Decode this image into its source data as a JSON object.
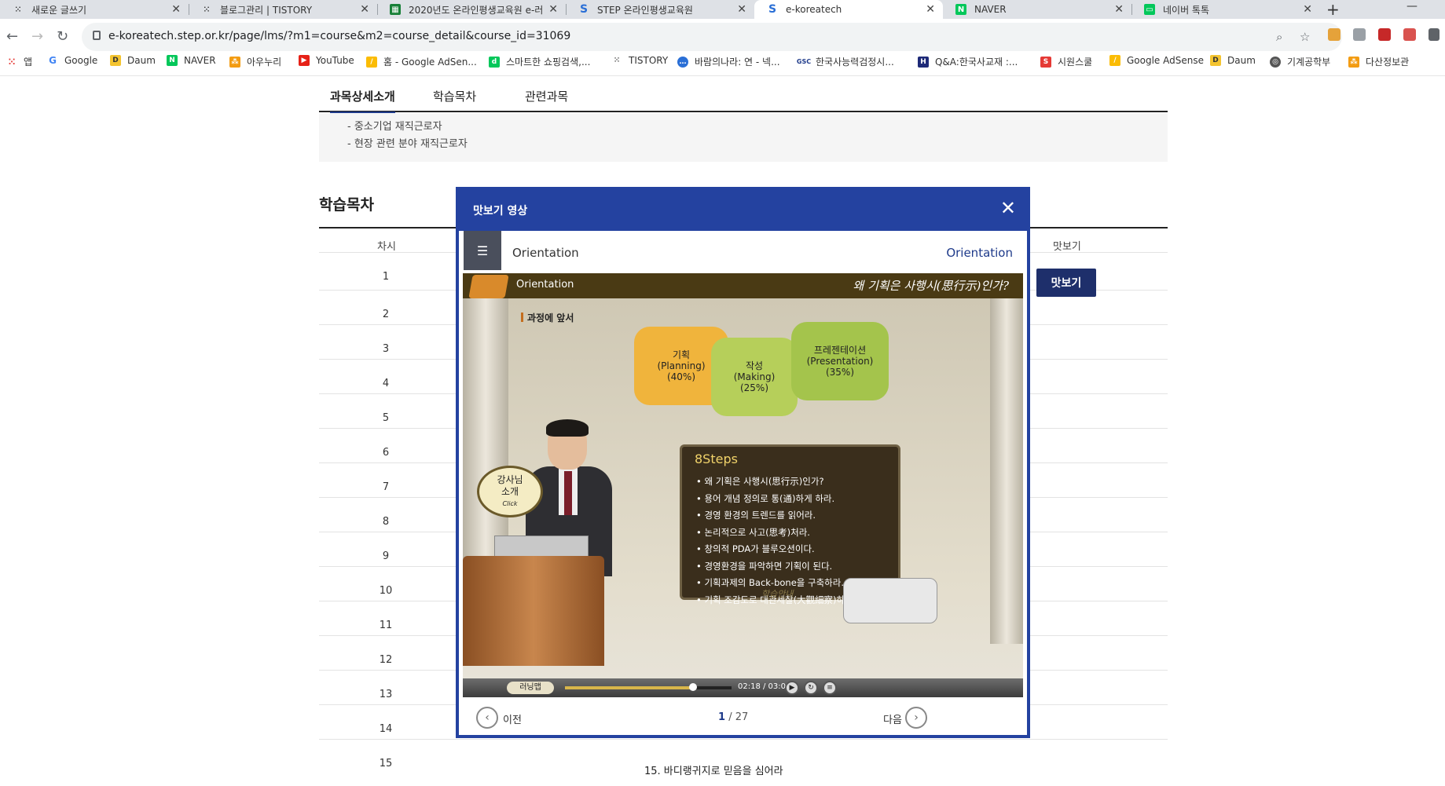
{
  "browser": {
    "tabs": [
      {
        "title": "새로운 글쓰기",
        "icon": "tistory-icon",
        "active": false
      },
      {
        "title": "블로그관리 | TISTORY",
        "icon": "tistory-icon",
        "active": false
      },
      {
        "title": "2020년도 온라인평생교육원 e-러",
        "icon": "sheets-icon",
        "active": false
      },
      {
        "title": "STEP 온라인평생교육원",
        "icon": "step-icon",
        "active": false
      },
      {
        "title": "e-koreatech",
        "icon": "step-icon",
        "active": true
      },
      {
        "title": "NAVER",
        "icon": "naver-icon",
        "active": false
      },
      {
        "title": "네이버 톡톡",
        "icon": "talk-icon",
        "active": false
      }
    ],
    "url": "e-koreatech.step.or.kr/page/lms/?m1=course&m2=course_detail&course_id=31069",
    "bookmarks": [
      "앱",
      "Google",
      "Daum",
      "NAVER",
      "아우누리",
      "YouTube",
      "홈 - Google AdSen...",
      "스마트한 쇼핑검색,...",
      "TISTORY",
      "바람의나라: 연 - 넥...",
      "한국사능력검정시...",
      "Q&A:한국사교재 :...",
      "시원스쿨",
      "Google AdSense",
      "Daum",
      "기계공학부",
      "다산정보관"
    ]
  },
  "content_tabs": [
    "과목상세소개",
    "학습목차",
    "관련과목"
  ],
  "info_lines": [
    "- 중소기업 재직근로자",
    "- 현장 관련 분야 재직근로자"
  ],
  "toc": {
    "title": "학습목차",
    "col_num": "차시",
    "col_preview": "맛보기",
    "preview_button": "맛보기",
    "rows": [
      "1",
      "2",
      "3",
      "4",
      "5",
      "6",
      "7",
      "8",
      "9",
      "10",
      "11",
      "12",
      "13",
      "14",
      "15"
    ],
    "row15_title": "15. 바디랭귀지로 믿음을 심어라"
  },
  "modal": {
    "title": "맛보기 영상",
    "lesson_left": "Orientation",
    "lesson_right": "Orientation",
    "video": {
      "bar_left": "Orientation",
      "bar_right": "왜 기획은 사행시(思行示)인가?",
      "subtitle": "과정에 앞서",
      "pieces": [
        {
          "name": "기획",
          "en": "(Planning)",
          "pct": "(40%)",
          "color": "#f0b43c"
        },
        {
          "name": "작성",
          "en": "(Making)",
          "pct": "(25%)",
          "color": "#b6cf5a"
        },
        {
          "name": "프레젠테이션",
          "en": "(Presentation)",
          "pct": "(35%)",
          "color": "#a4c44c"
        }
      ],
      "steps_title": "8Steps",
      "steps": [
        "왜 기획은 사행시(思行示)인가?",
        "용어 개념 정의로 통(通)하게 하라.",
        "경영 환경의 트렌드를 읽어라.",
        "논리적으로 사고(思考)처라.",
        "창의적 PDA가 블루오션이다.",
        "경영환경을 파악하면 기획이 된다.",
        "기획과제의 Back-bone을 구축하라.",
        "기획 조감도로 대관세찰(大觀細察)하라."
      ],
      "bubble_line1": "강사님",
      "bubble_line2": "소개",
      "bubble_click": "Click",
      "hint": "학습안내",
      "learn_btn": "러닝맵",
      "time": "02:18 / 03:00",
      "progress": 0.77
    },
    "prev_label": "이전",
    "next_label": "다음",
    "page_current": "1",
    "page_total": "/ 27"
  }
}
